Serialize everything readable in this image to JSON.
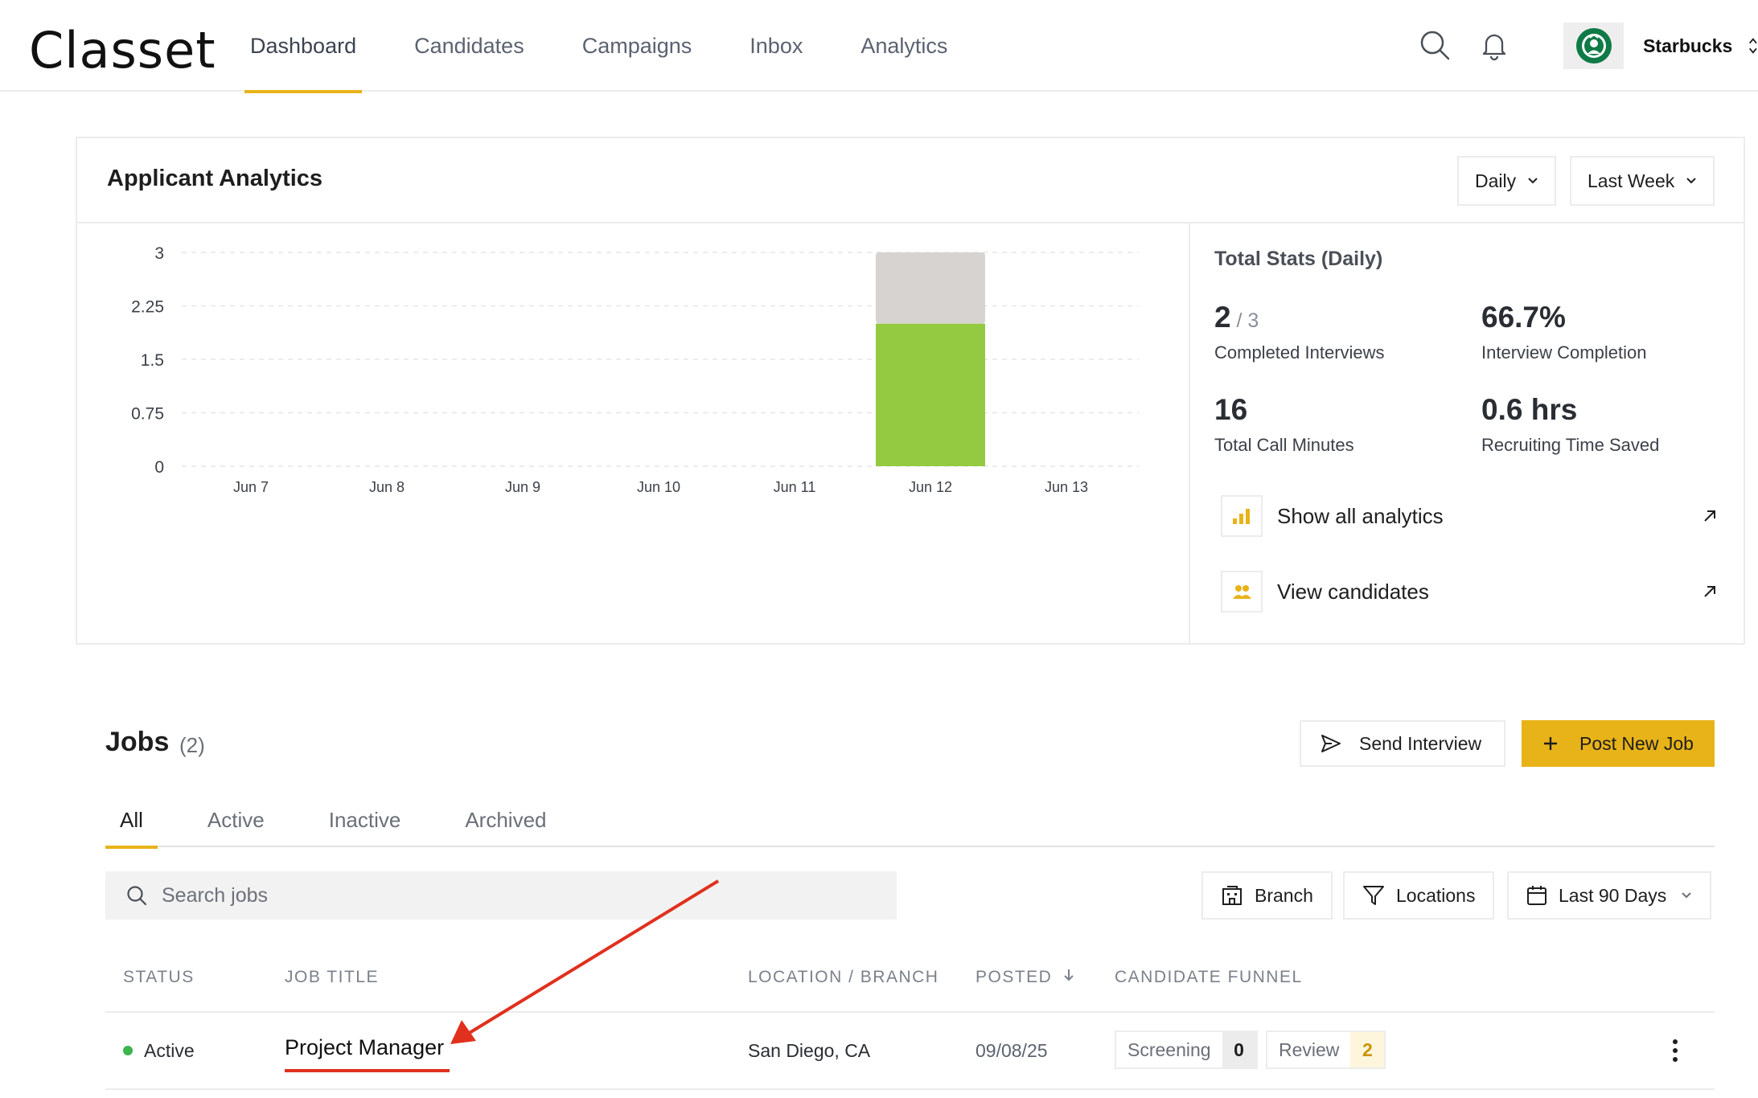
{
  "app": {
    "logo": "Classet",
    "nav": [
      "Dashboard",
      "Candidates",
      "Campaigns",
      "Inbox",
      "Analytics"
    ],
    "active_nav": "Dashboard",
    "account_name": "Starbucks"
  },
  "analytics": {
    "title": "Applicant Analytics",
    "interval_select": "Daily",
    "range_select": "Last Week",
    "stats_title": "Total Stats (Daily)",
    "stats": {
      "completed_interviews_value": "2",
      "completed_interviews_total": " / 3",
      "completed_interviews_label": "Completed Interviews",
      "interview_completion_value": "66.7%",
      "interview_completion_label": "Interview Completion",
      "call_minutes_value": "16",
      "call_minutes_label": "Total Call Minutes",
      "time_saved_value": "0.6 hrs",
      "time_saved_label": "Recruiting Time Saved"
    },
    "links": {
      "show_all": "Show all analytics",
      "view_candidates": "View candidates"
    }
  },
  "chart_data": {
    "type": "bar",
    "stacked": true,
    "categories": [
      "Jun 7",
      "Jun 8",
      "Jun 9",
      "Jun 10",
      "Jun 11",
      "Jun 12",
      "Jun 13"
    ],
    "y_ticks": [
      "0",
      "0.75",
      "1.5",
      "2.25",
      "3"
    ],
    "ylim": [
      0,
      3
    ],
    "grid": true,
    "series": [
      {
        "values": [
          0,
          0,
          0,
          0,
          0,
          2,
          0
        ],
        "color": "#93ca42"
      },
      {
        "values": [
          0,
          0,
          0,
          0,
          0,
          1,
          0
        ],
        "color": "#d6d3d1"
      }
    ]
  },
  "jobs": {
    "title": "Jobs",
    "count": "(2)",
    "send_interview": "Send Interview",
    "post_new_job": "Post New Job",
    "tabs": [
      "All",
      "Active",
      "Inactive",
      "Archived"
    ],
    "active_tab": "All",
    "search_placeholder": "Search jobs",
    "filters": {
      "branch": "Branch",
      "locations": "Locations",
      "date_range": "Last 90 Days"
    },
    "columns": {
      "status": "STATUS",
      "job_title": "JOB TITLE",
      "location": "LOCATION / BRANCH",
      "posted": "POSTED",
      "funnel": "CANDIDATE FUNNEL"
    },
    "rows": [
      {
        "status": "Active",
        "title": "Project Manager",
        "location": "San Diego, CA",
        "posted": "09/08/25",
        "funnel": [
          {
            "stage": "Screening",
            "count": "0"
          },
          {
            "stage": "Review",
            "count": "2"
          }
        ]
      }
    ]
  },
  "colors": {
    "accent": "#e8b318",
    "bar_green": "#93ca42",
    "bar_gray": "#d6d3d1",
    "status_active": "#3cb54a",
    "annotation_red": "#e0301e"
  }
}
